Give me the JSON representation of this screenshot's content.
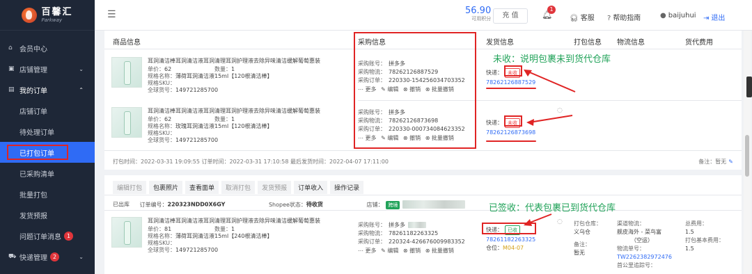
{
  "sidebar": {
    "logo_cn": "百馨汇",
    "logo_en": "Parkway",
    "items": [
      {
        "label": "会员中心",
        "icon": "home-icon"
      },
      {
        "label": "店铺管理",
        "icon": "store-icon",
        "arrow": "⌄"
      },
      {
        "label": "我的订单",
        "icon": "order-icon",
        "arrow": "⌃"
      },
      {
        "label": "店铺订单"
      },
      {
        "label": "待处理订单"
      },
      {
        "label": "已打包订单"
      },
      {
        "label": "已采购清单"
      },
      {
        "label": "批量打包"
      },
      {
        "label": "发货预报"
      },
      {
        "label": "问题订单消息",
        "badge": "1"
      },
      {
        "label": "快递管理",
        "icon": "truck-icon",
        "badge": "2",
        "arrow": "⌄"
      }
    ]
  },
  "header": {
    "balance": "56.90",
    "balance_label": "可用积分",
    "recharge": "充 值",
    "bell_count": "1",
    "service": "客服",
    "help": "帮助指南",
    "user": "baijuhui",
    "logout": "退出"
  },
  "table": {
    "headers": [
      "商品信息",
      "采购信息",
      "发货信息",
      "打包信息",
      "物流信息",
      "货代费用"
    ]
  },
  "order1": {
    "items": [
      {
        "name": "耳洞清洁棒耳洞清洁液耳洞清理耳洞护理液去除异味清洁缓解葡萄惠装",
        "price_label": "单价：",
        "price": "62",
        "qty_label": "数量：",
        "qty": "1",
        "spec_label": "规格名称：",
        "spec": "薄荷耳洞清洁液15ml【120根清洁棒】",
        "sku_label": "规格SKU：",
        "gtin_label": "全球货号：",
        "gtin": "149721285700",
        "pur_account_label": "采购账号：",
        "pur_account": "拼多多",
        "pur_logistics_label": "采购物流：",
        "pur_logistics": "78262126887529",
        "pur_order_label": "采购订单：",
        "pur_order": "220330-154256034703352",
        "actions": [
          "⋯ 更多",
          "✎ 编辑",
          "⊗ 撤销",
          "⊗ 批量撤销"
        ],
        "ship_label": "快递：",
        "ship_status": "未收",
        "ship_tracking": "78262126887529"
      },
      {
        "name": "耳洞清洁棒耳洞清洁液耳洞清理耳洞护理液去除异味清洁缓解葡萄惠装",
        "price_label": "单价：",
        "price": "62",
        "qty_label": "数量：",
        "qty": "1",
        "spec_label": "规格名称：",
        "spec": "玫瑰耳洞清洁液15ml【120根清洁棒】",
        "sku_label": "规格SKU：",
        "gtin_label": "全球货号：",
        "gtin": "149721285700",
        "pur_account_label": "采购账号：",
        "pur_account": "拼多多",
        "pur_logistics_label": "采购物流：",
        "pur_logistics": "78262126873698",
        "pur_order_label": "采购订单：",
        "pur_order": "220330-000734084623352",
        "actions": [
          "⋯ 更多",
          "✎ 编辑",
          "⊗ 撤销",
          "⊗ 批量撤销"
        ],
        "ship_label": "快递：",
        "ship_status": "未收",
        "ship_tracking": "78262126873698"
      }
    ],
    "timeline": "打包时间：2022-03-31 19:09:55     订单时间：2022-03-31 17:10:58     最后发货时间：2022-04-07 17:11:00",
    "remark_label": "备注：",
    "remark": "暂无"
  },
  "annotations": {
    "unreceived": "未收：说明包裹未到货代仓库",
    "signed": "已签收：代表包裹已到货代仓库"
  },
  "order2": {
    "tabs": [
      "编辑打包",
      "包裹照片",
      "查看面单",
      "取消打包",
      "发货预报",
      "订单收入",
      "操作记录"
    ],
    "status": "已出库",
    "order_no_label": "订单编号：",
    "order_no": "220323NDD0X6GY",
    "shopee_label": "Shopee状态：",
    "shopee_status": "待收货",
    "shop_label": "店铺：",
    "shop_badge": "跨境",
    "item": {
      "name": "耳洞清洁棒耳洞清洁液耳洞清理耳洞护理液去除异味清洁缓解葡萄惠装",
      "price_label": "单价：",
      "price": "81",
      "qty_label": "数量：",
      "qty": "1",
      "spec_label": "规格名称：",
      "spec": "薄荷耳洞清洁液15ml【240根清洁棒】",
      "sku_label": "规格SKU：",
      "gtin_label": "全球货号：",
      "gtin": "149721285700",
      "pur_account_label": "采购账号：",
      "pur_account": "拼多多",
      "pur_logistics_label": "采购物流：",
      "pur_logistics": "78261182263325",
      "pur_order_label": "采购订单：",
      "pur_order": "220324-426676009983352",
      "actions": [
        "⋯ 更多",
        "✎ 编辑",
        "⊗ 撤销",
        "⊗ 批量撤销"
      ],
      "ship_label": "快递：",
      "ship_status": "已收",
      "ship_tracking": "78261182263325",
      "slot_label": "仓位：",
      "slot": "M04-07"
    },
    "pack": {
      "warehouse_label": "打包仓库：",
      "warehouse": "义乌仓",
      "remark_label": "备注：",
      "remark": "暂无"
    },
    "logistics": {
      "line_label": "渠道物流：",
      "line": "舰皮海外 - 菜鸟富",
      "mode": "（空运）",
      "no_label": "物流单号：",
      "no": "TW2262382972476",
      "first_label": "首公里追踪号："
    },
    "fee": {
      "total_label": "总费用：",
      "total": "1.5",
      "base_label": "打包基本费用：",
      "base": "1.5"
    }
  },
  "colors": {
    "accent": "#2f6bf5",
    "alert": "#e02424",
    "annotation": "#22a35a",
    "sidebar": "#1e2737"
  }
}
